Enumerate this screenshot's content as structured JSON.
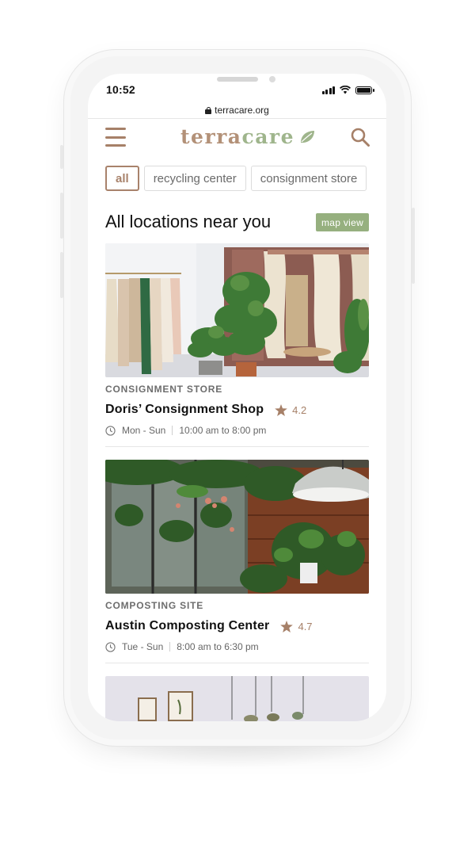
{
  "status_bar": {
    "time": "10:52"
  },
  "browser": {
    "url": "terracare.org"
  },
  "brand": {
    "logo_part1": "terra",
    "logo_part2": "care",
    "accent": "#a8826b",
    "green": "#96b07f"
  },
  "filters": [
    {
      "label": "all",
      "active": true
    },
    {
      "label": "recycling center",
      "active": false
    },
    {
      "label": "consignment store",
      "active": false
    }
  ],
  "main": {
    "title": "All locations near you",
    "map_button": "map view"
  },
  "locations": [
    {
      "category": "CONSIGNMENT STORE",
      "name": "Doris’ Consignment Shop",
      "rating": "4.2",
      "days": "Mon - Sun",
      "hours": "10:00 am to 8:00 pm"
    },
    {
      "category": "COMPOSTING SITE",
      "name": "Austin Composting Center",
      "rating": "4.7",
      "days": "Tue - Sun",
      "hours": "8:00 am to 6:30 pm"
    }
  ]
}
